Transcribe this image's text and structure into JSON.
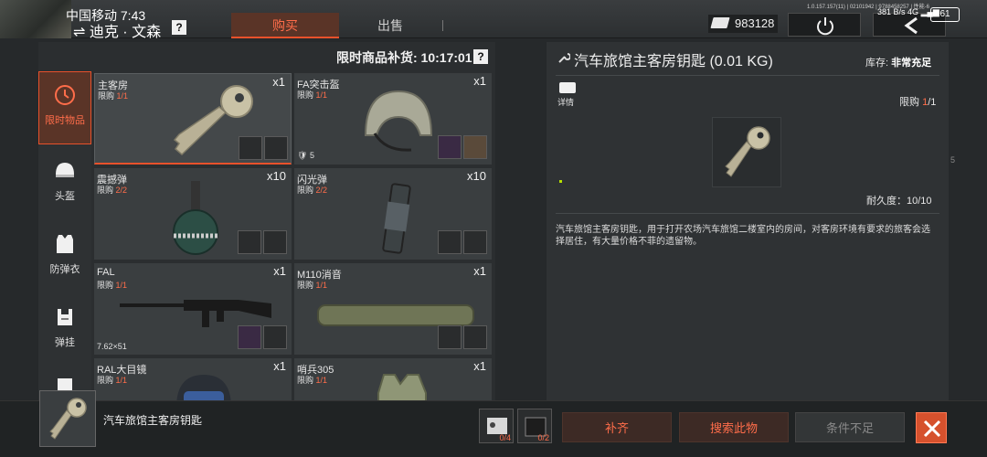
{
  "status_bar": {
    "carrier_time": "中国移动 7:43",
    "build_info": "1.0.157.157(11) | 02101942 | 9788458257 | 性能-6",
    "net_speed": "381 B/s",
    "net_type": "4G",
    "battery": "61"
  },
  "header": {
    "player_name": "⇌ 迪克 · 文森",
    "help": "?",
    "tabs": [
      {
        "label": "购买",
        "active": true
      },
      {
        "label": "出售",
        "active": false
      }
    ],
    "currency_value": "983128"
  },
  "sidebar": {
    "items": [
      {
        "label": "限时物品",
        "icon": "clock-icon",
        "active": true
      },
      {
        "label": "头盔",
        "icon": "helmet-icon",
        "active": false
      },
      {
        "label": "防弹衣",
        "icon": "vest-icon",
        "active": false
      },
      {
        "label": "弹挂",
        "icon": "chest-rig-icon",
        "active": false
      }
    ]
  },
  "shop": {
    "restock_label": "限时商品补货: 10:17:01",
    "help": "?",
    "limit_prefix": "限购",
    "items": [
      {
        "name": "主客房",
        "qty": "x1",
        "limit_used": "1",
        "limit_total": "/1",
        "image": "key-icon",
        "note": ""
      },
      {
        "name": "FA突击盔",
        "qty": "x1",
        "limit_used": "1",
        "limit_total": "/1",
        "image": "helmet-icon",
        "note": "5"
      },
      {
        "name": "震撼弹",
        "qty": "x10",
        "limit_used": "2",
        "limit_total": "/2",
        "image": "stun-grenade-icon",
        "note": ""
      },
      {
        "name": "闪光弹",
        "qty": "x10",
        "limit_used": "2",
        "limit_total": "/2",
        "image": "flashbang-icon",
        "note": ""
      },
      {
        "name": "FAL",
        "qty": "x1",
        "limit_used": "1",
        "limit_total": "/1",
        "image": "rifle-icon",
        "note": "7.62×51"
      },
      {
        "name": "M110消音",
        "qty": "x1",
        "limit_used": "1",
        "limit_total": "/1",
        "image": "suppressor-icon",
        "note": ""
      },
      {
        "name": "RAL大目镜",
        "qty": "x1",
        "limit_used": "1",
        "limit_total": "/1",
        "image": "goggles-helmet-icon",
        "note": ""
      },
      {
        "name": "哨兵305",
        "qty": "x1",
        "limit_used": "1",
        "limit_total": "/1",
        "image": "armor-vest-icon",
        "note": ""
      }
    ]
  },
  "detail": {
    "title": "汽车旅馆主客房钥匙 (0.01 KG)",
    "stock_label": "库存:",
    "stock_value": "非常充足",
    "info_label": "详情",
    "limit_prefix": "限购",
    "limit_used": "1",
    "limit_total": "/1",
    "durability": "耐久度：10/10",
    "description": "汽车旅馆主客房钥匙，用于打开农场汽车旅馆二楼室内的房间，对客房环境有要求的旅客会选择居住，有大量价格不菲的遗留物。",
    "scroll_tag": "5"
  },
  "footer": {
    "item_name": "汽车旅馆主客房钥匙",
    "requirements": [
      {
        "icon": "material-icon",
        "count": "0/4"
      },
      {
        "icon": "case-icon",
        "count": "0/2"
      }
    ],
    "fill_label": "补齐",
    "search_label": "搜索此物",
    "condition_label": "条件不足",
    "close_icon": "close-icon"
  },
  "colors": {
    "accent": "#e8512b",
    "accent_text": "#ff6d4a",
    "panel": "#2f3234",
    "background": "#26292b"
  }
}
